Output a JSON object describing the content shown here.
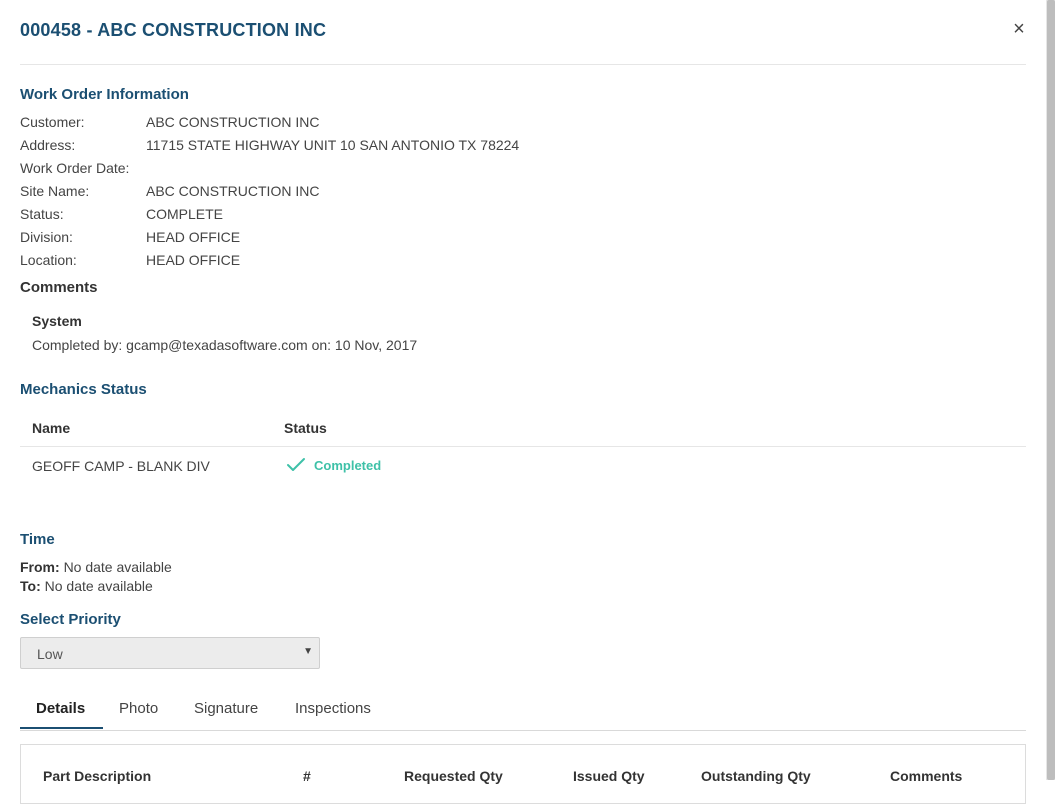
{
  "header": {
    "title": "000458 - ABC CONSTRUCTION INC",
    "close_label": "×"
  },
  "work_order": {
    "title": "Work Order Information",
    "fields": [
      {
        "label": "Customer:",
        "value": "ABC CONSTRUCTION INC"
      },
      {
        "label": "Address:",
        "value": "11715 STATE HIGHWAY UNIT 10 SAN ANTONIO TX 78224"
      },
      {
        "label": "Work Order Date:",
        "value": ""
      },
      {
        "label": "Site Name:",
        "value": "ABC CONSTRUCTION INC"
      },
      {
        "label": "Status:",
        "value": "COMPLETE"
      },
      {
        "label": "Division:",
        "value": "HEAD OFFICE"
      },
      {
        "label": "Location:",
        "value": "HEAD OFFICE"
      }
    ]
  },
  "comments": {
    "title": "Comments",
    "author": "System",
    "text": "Completed by: gcamp@texadasoftware.com on: 10 Nov, 2017"
  },
  "mechanics": {
    "title": "Mechanics Status",
    "headers": {
      "name": "Name",
      "status": "Status"
    },
    "rows": [
      {
        "name": "GEOFF CAMP - BLANK DIV",
        "status": "Completed",
        "status_icon": "check-icon"
      }
    ]
  },
  "time": {
    "title": "Time",
    "from_label": "From:",
    "from_value": "No date available",
    "to_label": "To:",
    "to_value": "No date available"
  },
  "priority": {
    "title": "Select Priority",
    "selected": "Low"
  },
  "tabs": [
    {
      "label": "Details",
      "active": true
    },
    {
      "label": "Photo",
      "active": false
    },
    {
      "label": "Signature",
      "active": false
    },
    {
      "label": "Inspections",
      "active": false
    }
  ],
  "parts_table": {
    "headers": [
      "Part Description",
      "#",
      "Requested Qty",
      "Issued Qty",
      "Outstanding Qty",
      "Comments"
    ]
  },
  "colors": {
    "accent": "#1b4f72",
    "success": "#3ec1a8"
  }
}
